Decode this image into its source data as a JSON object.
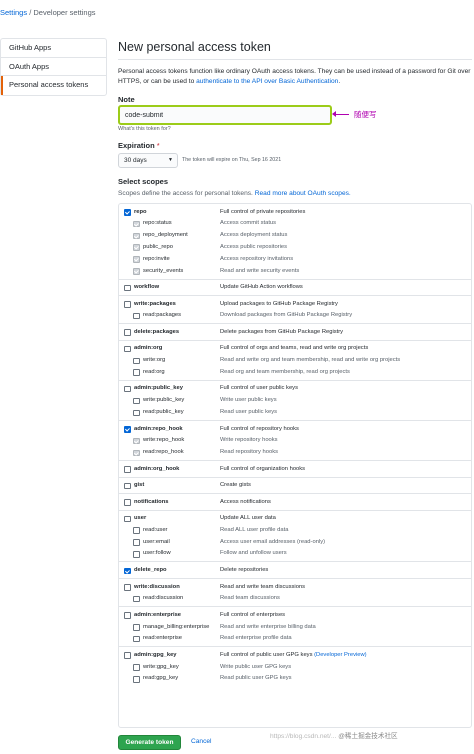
{
  "breadcrumb": {
    "settings": "Settings",
    "sep": "/",
    "current": "Developer settings"
  },
  "sidebar": {
    "items": [
      {
        "label": "GitHub Apps"
      },
      {
        "label": "OAuth Apps"
      },
      {
        "label": "Personal access tokens"
      }
    ]
  },
  "page": {
    "title": "New personal access token",
    "description": "Personal access tokens function like ordinary OAuth access tokens. They can be used instead of a password for Git over HTTPS, or can be used to ",
    "description_link": "authenticate to the API over Basic Authentication",
    "description_end": "."
  },
  "note": {
    "label": "Note",
    "value": "code-submit",
    "annotation": "随便写",
    "hint": "What's this token for?"
  },
  "expiration": {
    "label": "Expiration",
    "required_mark": "*",
    "selected": "30 days",
    "text": "The token will expire on Thu, Sep 16 2021"
  },
  "scopes": {
    "label": "Select scopes",
    "description": "Scopes define the access for personal tokens. ",
    "description_link": "Read more about OAuth scopes.",
    "groups": [
      {
        "rows": [
          {
            "name": "repo",
            "desc": "Full control of private repositories",
            "state": "checked",
            "parent": true
          },
          {
            "name": "repo:status",
            "desc": "Access commit status",
            "state": "gray",
            "parent": false
          },
          {
            "name": "repo_deployment",
            "desc": "Access deployment status",
            "state": "gray",
            "parent": false
          },
          {
            "name": "public_repo",
            "desc": "Access public repositories",
            "state": "gray",
            "parent": false
          },
          {
            "name": "repo:invite",
            "desc": "Access repository invitations",
            "state": "gray",
            "parent": false
          },
          {
            "name": "security_events",
            "desc": "Read and write security events",
            "state": "gray",
            "parent": false
          }
        ]
      },
      {
        "rows": [
          {
            "name": "workflow",
            "desc": "Update GitHub Action workflows",
            "state": "empty",
            "parent": true
          }
        ]
      },
      {
        "rows": [
          {
            "name": "write:packages",
            "desc": "Upload packages to GitHub Package Registry",
            "state": "empty",
            "parent": true
          },
          {
            "name": "read:packages",
            "desc": "Download packages from GitHub Package Registry",
            "state": "empty",
            "parent": false
          }
        ]
      },
      {
        "rows": [
          {
            "name": "delete:packages",
            "desc": "Delete packages from GitHub Package Registry",
            "state": "empty",
            "parent": true
          }
        ]
      },
      {
        "rows": [
          {
            "name": "admin:org",
            "desc": "Full control of orgs and teams, read and write org projects",
            "state": "empty",
            "parent": true
          },
          {
            "name": "write:org",
            "desc": "Read and write org and team membership, read and write org projects",
            "state": "empty",
            "parent": false
          },
          {
            "name": "read:org",
            "desc": "Read org and team membership, read org projects",
            "state": "empty",
            "parent": false
          }
        ]
      },
      {
        "rows": [
          {
            "name": "admin:public_key",
            "desc": "Full control of user public keys",
            "state": "empty",
            "parent": true
          },
          {
            "name": "write:public_key",
            "desc": "Write user public keys",
            "state": "empty",
            "parent": false
          },
          {
            "name": "read:public_key",
            "desc": "Read user public keys",
            "state": "empty",
            "parent": false
          }
        ]
      },
      {
        "rows": [
          {
            "name": "admin:repo_hook",
            "desc": "Full control of repository hooks",
            "state": "checked",
            "parent": true
          },
          {
            "name": "write:repo_hook",
            "desc": "Write repository hooks",
            "state": "gray",
            "parent": false
          },
          {
            "name": "read:repo_hook",
            "desc": "Read repository hooks",
            "state": "gray",
            "parent": false
          }
        ]
      },
      {
        "rows": [
          {
            "name": "admin:org_hook",
            "desc": "Full control of organization hooks",
            "state": "empty",
            "parent": true
          }
        ]
      },
      {
        "rows": [
          {
            "name": "gist",
            "desc": "Create gists",
            "state": "empty",
            "parent": true
          }
        ]
      },
      {
        "rows": [
          {
            "name": "notifications",
            "desc": "Access notifications",
            "state": "empty",
            "parent": true
          }
        ]
      },
      {
        "rows": [
          {
            "name": "user",
            "desc": "Update ALL user data",
            "state": "empty",
            "parent": true
          },
          {
            "name": "read:user",
            "desc": "Read ALL user profile data",
            "state": "empty",
            "parent": false
          },
          {
            "name": "user:email",
            "desc": "Access user email addresses (read-only)",
            "state": "empty",
            "parent": false
          },
          {
            "name": "user:follow",
            "desc": "Follow and unfollow users",
            "state": "empty",
            "parent": false
          }
        ]
      },
      {
        "rows": [
          {
            "name": "delete_repo",
            "desc": "Delete repositories",
            "state": "checked",
            "parent": true
          }
        ]
      },
      {
        "rows": [
          {
            "name": "write:discussion",
            "desc": "Read and write team discussions",
            "state": "empty",
            "parent": true
          },
          {
            "name": "read:discussion",
            "desc": "Read team discussions",
            "state": "empty",
            "parent": false
          }
        ]
      },
      {
        "rows": [
          {
            "name": "admin:enterprise",
            "desc": "Full control of enterprises",
            "state": "empty",
            "parent": true
          },
          {
            "name": "manage_billing:enterprise",
            "desc": "Read and write enterprise billing data",
            "state": "empty",
            "parent": false
          },
          {
            "name": "read:enterprise",
            "desc": "Read enterprise profile data",
            "state": "empty",
            "parent": false
          }
        ]
      },
      {
        "rows": [
          {
            "name": "admin:gpg_key",
            "desc": "Full control of public user GPG keys",
            "desc_link": "(Developer Preview)",
            "state": "empty",
            "parent": true
          },
          {
            "name": "write:gpg_key",
            "desc": "Write public user GPG keys",
            "state": "empty",
            "parent": false
          },
          {
            "name": "read:gpg_key",
            "desc": "Read public user GPG keys",
            "state": "empty",
            "parent": false
          }
        ]
      }
    ]
  },
  "actions": {
    "generate": "Generate token",
    "cancel": "Cancel"
  },
  "watermark": {
    "text": "@稀土掘金技术社区",
    "faint": "https://blog.csdn.net/..."
  }
}
